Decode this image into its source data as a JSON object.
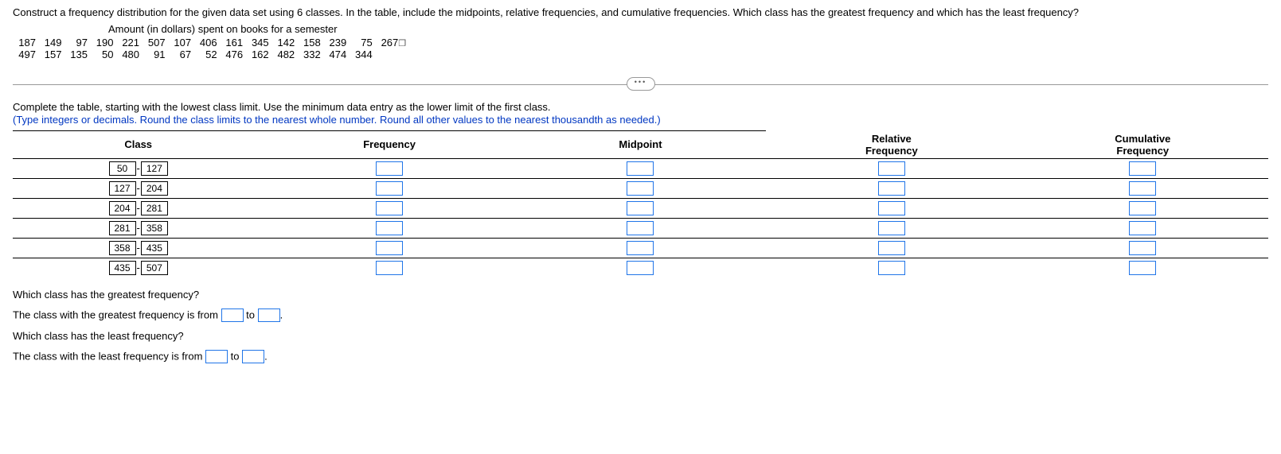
{
  "question": "Construct a frequency distribution for the given data set using 6 classes. In the table, include the midpoints, relative frequencies, and cumulative frequencies. Which class has the greatest frequency and which has the least frequency?",
  "data_title": "Amount (in dollars) spent on books for a semester",
  "data_row1": "187   149     97   190   221   507   107   406   161   345   142   158   239     75   267",
  "data_row2": "497   157   135     50   480     91     67     52   476   162   482   332   474   344",
  "instruction_main": "Complete the table, starting with the lowest class limit. Use the minimum data entry as the lower limit of the first class.",
  "instruction_sub": "(Type integers or decimals. Round the class limits to the nearest whole number. Round all other values to the nearest thousandth as needed.)",
  "headers": {
    "class": "Class",
    "freq": "Frequency",
    "mid": "Midpoint",
    "rel": "Relative\nFrequency",
    "cum": "Cumulative\nFrequency"
  },
  "rows": [
    {
      "lo": "50",
      "hi": "127"
    },
    {
      "lo": "127",
      "hi": "204"
    },
    {
      "lo": "204",
      "hi": "281"
    },
    {
      "lo": "281",
      "hi": "358"
    },
    {
      "lo": "358",
      "hi": "435"
    },
    {
      "lo": "435",
      "hi": "507"
    }
  ],
  "q_greatest": "Which class has the greatest frequency?",
  "a_greatest_pre": "The class with the greatest frequency is from ",
  "to": " to ",
  "period": ".",
  "q_least": "Which class has the least frequency?",
  "a_least_pre": "The class with the least frequency is from ",
  "ellipsis": "•••"
}
